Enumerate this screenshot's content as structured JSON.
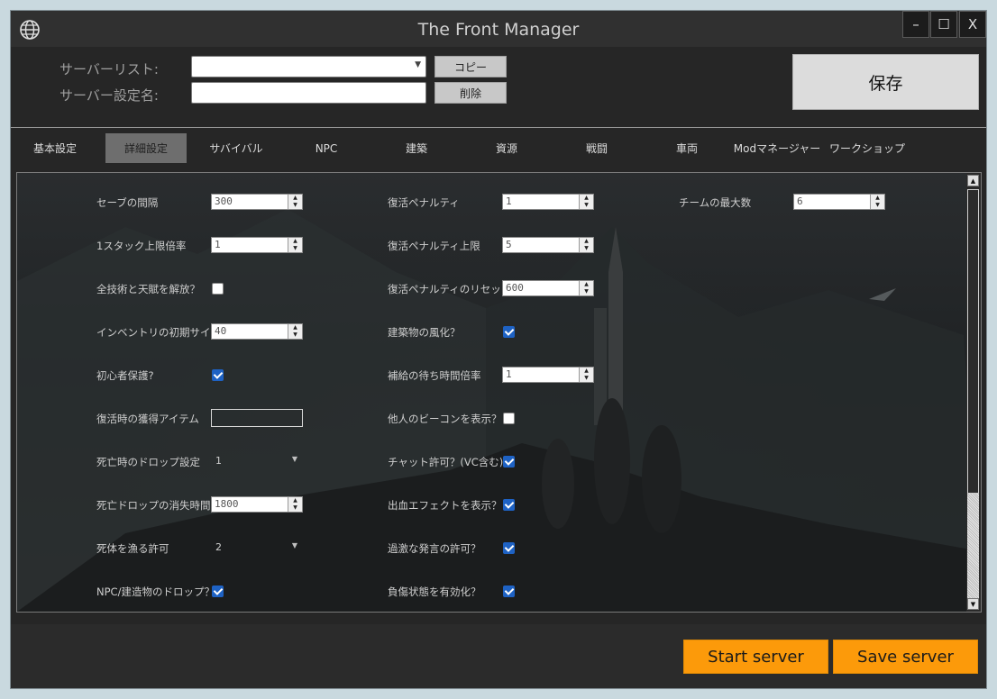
{
  "window": {
    "title": "The Front Manager",
    "controls": {
      "minimize": "–",
      "maximize": "☐",
      "close": "X"
    }
  },
  "top": {
    "server_list_label": "サーバーリスト:",
    "server_list_value": "",
    "server_config_label": "サーバー設定名:",
    "server_config_value": "",
    "copy_label": "コピー",
    "delete_label": "削除",
    "save_label": "保存"
  },
  "tabs": [
    {
      "label": "基本設定",
      "active": false
    },
    {
      "label": "詳細設定",
      "active": true
    },
    {
      "label": "サバイバル",
      "active": false
    },
    {
      "label": "NPC",
      "active": false
    },
    {
      "label": "建築",
      "active": false
    },
    {
      "label": "資源",
      "active": false
    },
    {
      "label": "戦闘",
      "active": false
    },
    {
      "label": "車両",
      "active": false
    },
    {
      "label": "Modマネージャー",
      "active": false
    },
    {
      "label": "ワークショップ",
      "active": false
    }
  ],
  "settings": {
    "col1": [
      {
        "label": "セーブの間隔",
        "type": "spin",
        "value": "300"
      },
      {
        "label": "1スタック上限倍率",
        "type": "spin",
        "value": "1"
      },
      {
        "label": "全技術と天賦を解放？",
        "type": "check",
        "checked": false
      },
      {
        "label": "インベントリの初期サイズ",
        "type": "spin",
        "value": "40"
      },
      {
        "label": "初心者保護?",
        "type": "check",
        "checked": true
      },
      {
        "label": "復活時の獲得アイテム",
        "type": "text",
        "value": ""
      },
      {
        "label": "死亡時のドロップ設定",
        "type": "combo",
        "value": "1"
      },
      {
        "label": "死亡ドロップの消失時間",
        "type": "spin",
        "value": "1800"
      },
      {
        "label": "死体を漁る許可",
        "type": "combo",
        "value": "2"
      },
      {
        "label": "NPC/建造物のドロップ？",
        "type": "check",
        "checked": true
      }
    ],
    "col2": [
      {
        "label": "復活ペナルティ",
        "type": "spin",
        "value": "1"
      },
      {
        "label": "復活ペナルティ上限",
        "type": "spin",
        "value": "5"
      },
      {
        "label": "復活ペナルティのリセット",
        "type": "spin",
        "value": "600"
      },
      {
        "label": "建築物の風化？",
        "type": "check",
        "checked": true
      },
      {
        "label": "補給の待ち時間倍率",
        "type": "spin",
        "value": "1"
      },
      {
        "label": "他人のビーコンを表示？",
        "type": "check",
        "checked": false
      },
      {
        "label": "チャット許可？(VC含む)",
        "type": "check",
        "checked": true
      },
      {
        "label": "出血エフェクトを表示？",
        "type": "check",
        "checked": true
      },
      {
        "label": "過激な発言の許可？",
        "type": "check",
        "checked": true
      },
      {
        "label": "負傷状態を有効化？",
        "type": "check",
        "checked": true
      }
    ],
    "col3": [
      {
        "label": "チームの最大数",
        "type": "spin",
        "value": "6"
      }
    ]
  },
  "footer": {
    "start_label": "Start server",
    "save_label": "Save server"
  },
  "colors": {
    "accent_orange": "#fc9a0a",
    "checkbox_blue": "#1e62c4",
    "active_tab": "#6e6e6e"
  }
}
